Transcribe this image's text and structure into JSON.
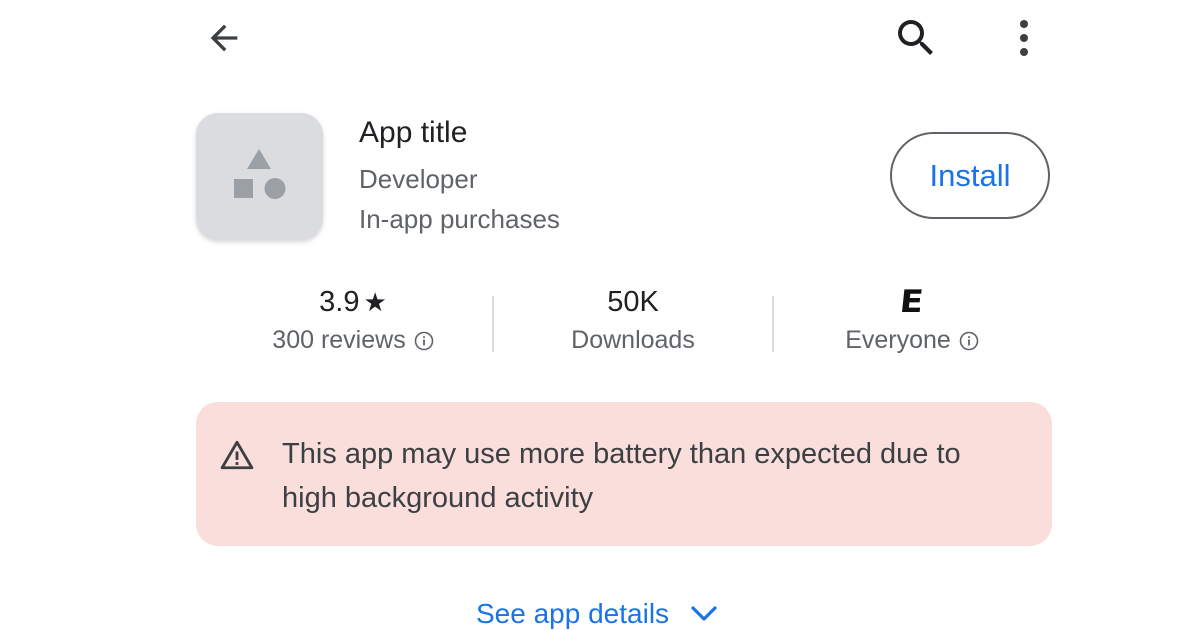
{
  "header": {
    "back_icon": "arrow-back-icon",
    "search_icon": "search-icon",
    "more_icon": "more-vert-icon"
  },
  "app": {
    "icon": "app-placeholder-icon",
    "title": "App title",
    "developer": "Developer",
    "purchases": "In-app purchases",
    "install_label": "Install"
  },
  "stats": {
    "rating": {
      "value": "3.9",
      "star": "★",
      "label": "300 reviews"
    },
    "downloads": {
      "value": "50K",
      "label": "Downloads"
    },
    "content_rating": {
      "badge": "E",
      "label": "Everyone"
    }
  },
  "warning": {
    "icon": "warning-triangle-icon",
    "text": "This app may use more battery than expected due to high background activity"
  },
  "footer": {
    "see_details_label": "See app details",
    "chevron_icon": "chevron-down-icon"
  },
  "colors": {
    "accent": "#1a73e8",
    "warning_bg": "#f9dedc",
    "icon_bg": "#dadce0",
    "secondary_text": "#5f6368"
  }
}
